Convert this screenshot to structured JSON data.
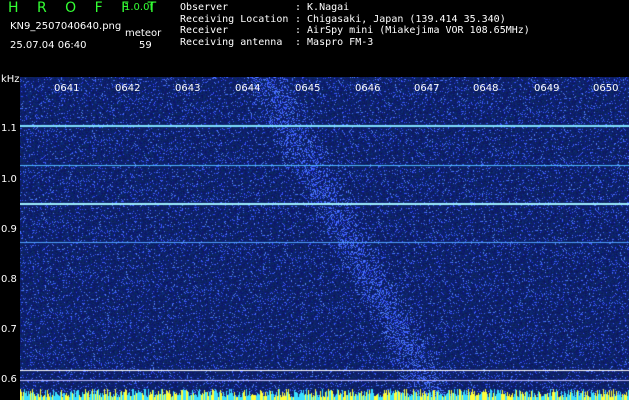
{
  "header": {
    "logo": "H R O F F T",
    "version": "1.0.0f",
    "filename": "KN9_2507040640.png",
    "timestamp": "25.07.04 06:40",
    "meteor_label": "meteor",
    "meteor_count": "59"
  },
  "info": [
    {
      "key": "Observer",
      "value": ": K.Nagai"
    },
    {
      "key": "Receiving Location",
      "value": ": Chigasaki, Japan (139.414 35.340)"
    },
    {
      "key": "Receiver",
      "value": ": AirSpy mini (Miakejima VOR 108.65MHz)"
    },
    {
      "key": "Receiving antenna",
      "value": ": Maspro FM-3"
    }
  ],
  "spectrogram": {
    "y_unit": "kHz",
    "y_ticks": [
      "1.1",
      "1.0",
      "0.9",
      "0.8",
      "0.7",
      "0.6"
    ],
    "x_ticks": [
      "0641",
      "0642",
      "0643",
      "0644",
      "0645",
      "0646",
      "0647",
      "0648",
      "0649",
      "0650"
    ],
    "background": "#0a1560",
    "noise_color": "#3b6bff"
  }
}
